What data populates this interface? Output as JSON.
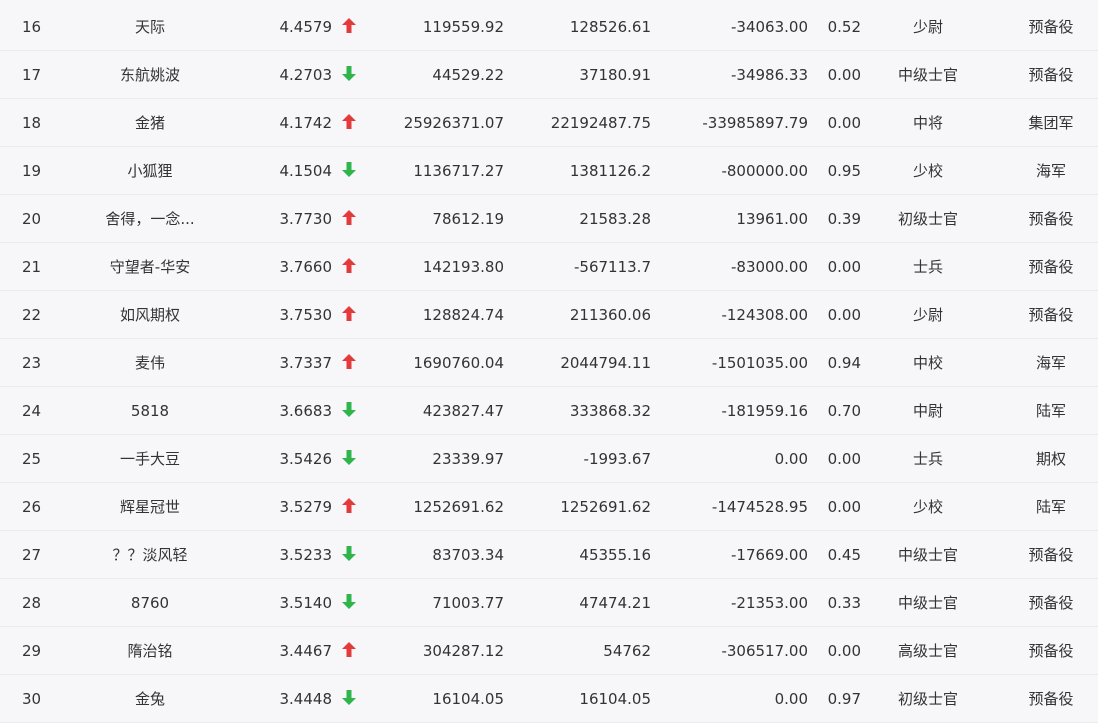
{
  "colors": {
    "up": "#e33b3b",
    "down": "#2fb54a"
  },
  "table": {
    "rows": [
      {
        "rank": "16",
        "name": "天际",
        "score": "4.4579",
        "trend": "up",
        "v1": "119559.92",
        "v2": "128526.61",
        "v3": "-34063.00",
        "ratio": "0.52",
        "rank_title": "少尉",
        "branch": "预备役"
      },
      {
        "rank": "17",
        "name": "东航姚波",
        "score": "4.2703",
        "trend": "down",
        "v1": "44529.22",
        "v2": "37180.91",
        "v3": "-34986.33",
        "ratio": "0.00",
        "rank_title": "中级士官",
        "branch": "预备役"
      },
      {
        "rank": "18",
        "name": "金猪",
        "score": "4.1742",
        "trend": "up",
        "v1": "25926371.07",
        "v2": "22192487.75",
        "v3": "-33985897.79",
        "ratio": "0.00",
        "rank_title": "中将",
        "branch": "集团军"
      },
      {
        "rank": "19",
        "name": "小狐狸",
        "score": "4.1504",
        "trend": "down",
        "v1": "1136717.27",
        "v2": "1381126.2",
        "v3": "-800000.00",
        "ratio": "0.95",
        "rank_title": "少校",
        "branch": "海军"
      },
      {
        "rank": "20",
        "name": "舍得，一念...",
        "score": "3.7730",
        "trend": "up",
        "v1": "78612.19",
        "v2": "21583.28",
        "v3": "13961.00",
        "ratio": "0.39",
        "rank_title": "初级士官",
        "branch": "预备役"
      },
      {
        "rank": "21",
        "name": "守望者-华安",
        "score": "3.7660",
        "trend": "up",
        "v1": "142193.80",
        "v2": "-567113.7",
        "v3": "-83000.00",
        "ratio": "0.00",
        "rank_title": "士兵",
        "branch": "预备役"
      },
      {
        "rank": "22",
        "name": "如风期权",
        "score": "3.7530",
        "trend": "up",
        "v1": "128824.74",
        "v2": "211360.06",
        "v3": "-124308.00",
        "ratio": "0.00",
        "rank_title": "少尉",
        "branch": "预备役"
      },
      {
        "rank": "23",
        "name": "麦伟",
        "score": "3.7337",
        "trend": "up",
        "v1": "1690760.04",
        "v2": "2044794.11",
        "v3": "-1501035.00",
        "ratio": "0.94",
        "rank_title": "中校",
        "branch": "海军"
      },
      {
        "rank": "24",
        "name": "5818",
        "score": "3.6683",
        "trend": "down",
        "v1": "423827.47",
        "v2": "333868.32",
        "v3": "-181959.16",
        "ratio": "0.70",
        "rank_title": "中尉",
        "branch": "陆军"
      },
      {
        "rank": "25",
        "name": "一手大豆",
        "score": "3.5426",
        "trend": "down",
        "v1": "23339.97",
        "v2": "-1993.67",
        "v3": "0.00",
        "ratio": "0.00",
        "rank_title": "士兵",
        "branch": "期权"
      },
      {
        "rank": "26",
        "name": "辉星冠世",
        "score": "3.5279",
        "trend": "up",
        "v1": "1252691.62",
        "v2": "1252691.62",
        "v3": "-1474528.95",
        "ratio": "0.00",
        "rank_title": "少校",
        "branch": "陆军"
      },
      {
        "rank": "27",
        "name": "？？淡风轻",
        "score": "3.5233",
        "trend": "down",
        "v1": "83703.34",
        "v2": "45355.16",
        "v3": "-17669.00",
        "ratio": "0.45",
        "rank_title": "中级士官",
        "branch": "预备役"
      },
      {
        "rank": "28",
        "name": "8760",
        "score": "3.5140",
        "trend": "down",
        "v1": "71003.77",
        "v2": "47474.21",
        "v3": "-21353.00",
        "ratio": "0.33",
        "rank_title": "中级士官",
        "branch": "预备役"
      },
      {
        "rank": "29",
        "name": "隋治铭",
        "score": "3.4467",
        "trend": "up",
        "v1": "304287.12",
        "v2": "54762",
        "v3": "-306517.00",
        "ratio": "0.00",
        "rank_title": "高级士官",
        "branch": "预备役"
      },
      {
        "rank": "30",
        "name": "金兔",
        "score": "3.4448",
        "trend": "down",
        "v1": "16104.05",
        "v2": "16104.05",
        "v3": "0.00",
        "ratio": "0.97",
        "rank_title": "初级士官",
        "branch": "预备役"
      }
    ]
  }
}
